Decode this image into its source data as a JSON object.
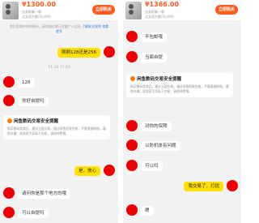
{
  "left": {
    "header": {
      "price": "¥1300.00",
      "line1": "交易前聊一聊",
      "line2": "买卖双方都可以评价",
      "buy_label": "立即购买"
    },
    "notice": {
      "text": "我们会保护你的隐私，请勿通过聊天泄露个人信息",
      "link": "了解安全规则 查看更多"
    },
    "messages": [
      {
        "type": "text",
        "side": "me",
        "text": "刚刚128还是256"
      },
      {
        "type": "time",
        "text": "11-18 15:43"
      },
      {
        "type": "text",
        "side": "them",
        "text": "128"
      },
      {
        "type": "text",
        "side": "them",
        "text": "你好自提吗"
      },
      {
        "type": "card",
        "title": "闲鱼数码交易安全提醒",
        "body": "购买数码类商品，建议当面交易，通过闲鱼担保交易，不要直接转账，谨防诈骗；如卖家引导私下交易，请保持警惕。"
      },
      {
        "type": "text",
        "side": "me",
        "text": "是，放心"
      },
      {
        "type": "text",
        "side": "them",
        "text": "请问你是那个地方的哦"
      },
      {
        "type": "text",
        "side": "them",
        "text": "可以自提吗"
      }
    ]
  },
  "right": {
    "header": {
      "price": "¥1366.00",
      "line1": "交易前聊一聊",
      "line2": "买卖双方都可以评价",
      "buy_label": "立即购买"
    },
    "messages": [
      {
        "type": "text",
        "side": "them",
        "text": "不包邮哦"
      },
      {
        "type": "text",
        "side": "them",
        "text": "当面自提"
      },
      {
        "type": "card",
        "title": "闲鱼数码交易安全提醒",
        "body": "购买数码类商品，建议当面交易，通过闲鱼担保交易，不要直接转账，谨防诈骗；如卖家引导私下交易，请保持警惕。"
      },
      {
        "type": "text",
        "side": "them",
        "text": "对你的保障"
      },
      {
        "type": "text",
        "side": "them",
        "text": "以防机体有问题"
      },
      {
        "type": "text",
        "side": "them",
        "text": "可以吗"
      },
      {
        "type": "text",
        "side": "me",
        "text": "我交易了，打扰"
      },
      {
        "type": "text",
        "side": "them",
        "text": "嗯"
      }
    ]
  },
  "colors": {
    "accent": "#ff5a1f",
    "my_bubble": "#ffe100",
    "avatar": "#ee0000",
    "link": "#2e7ff0"
  }
}
